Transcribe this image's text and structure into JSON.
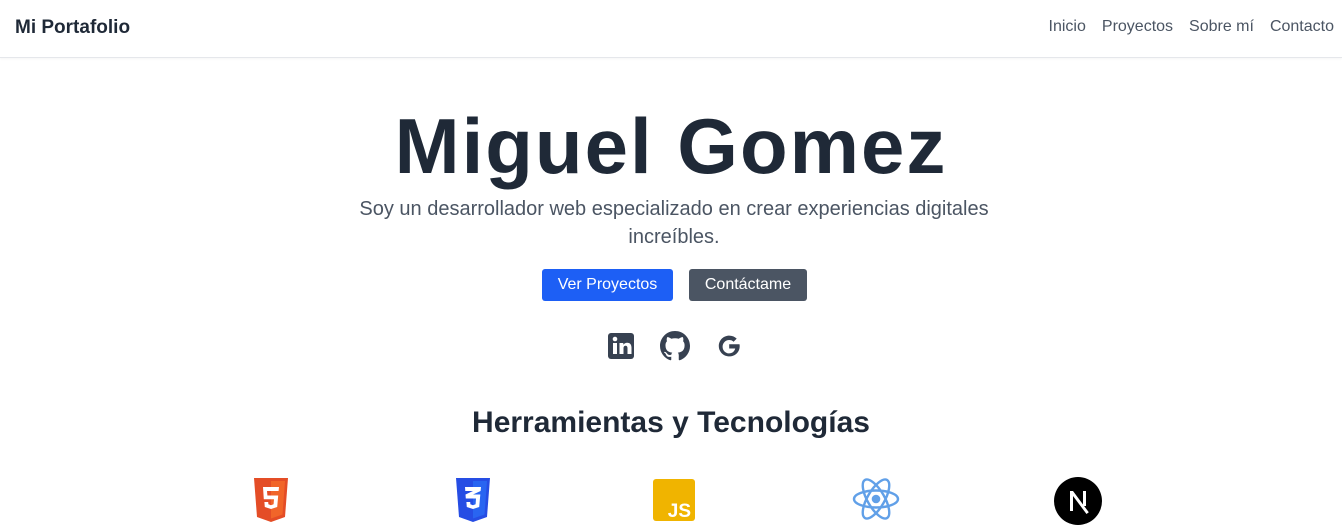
{
  "navbar": {
    "brand": "Mi Portafolio",
    "links": [
      "Inicio",
      "Proyectos",
      "Sobre mí",
      "Contacto"
    ]
  },
  "hero": {
    "name": "Miguel Gomez",
    "subtitle": "Soy un desarrollador web especializado en crear experiencias digitales increíbles.",
    "primary_button": "Ver Proyectos",
    "secondary_button": "Contáctame"
  },
  "social": [
    "linkedin-icon",
    "github-icon",
    "google-icon"
  ],
  "tools": {
    "title": "Herramientas y Tecnologías",
    "items": [
      {
        "icon": "html5-icon",
        "label": "5"
      },
      {
        "icon": "css3-icon",
        "label": "3"
      },
      {
        "icon": "javascript-icon",
        "label": "JS"
      },
      {
        "icon": "react-icon",
        "label": ""
      },
      {
        "icon": "nextjs-icon",
        "label": "N"
      }
    ]
  },
  "colors": {
    "primary": "#1d5ff5",
    "secondary": "#4b5563",
    "text": "#1f2937",
    "html5": "#e44d26",
    "css3": "#264de4",
    "javascript": "#f0b400",
    "react": "#61a0e8",
    "nextjs": "#000000"
  }
}
